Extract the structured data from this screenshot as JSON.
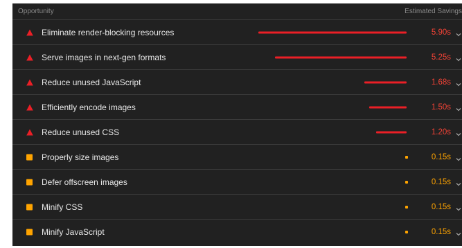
{
  "header": {
    "opportunity_label": "Opportunity",
    "savings_label": "Estimated Savings"
  },
  "colors": {
    "fail": "#eb1f26",
    "average": "#ffa400",
    "background": "#212121"
  },
  "rows": [
    {
      "label": "Eliminate render-blocking resources",
      "value": "5.90s",
      "seconds": 5.9,
      "status": "fail",
      "icon": "red-triangle-icon"
    },
    {
      "label": "Serve images in next-gen formats",
      "value": "5.25s",
      "seconds": 5.25,
      "status": "fail",
      "icon": "red-triangle-icon"
    },
    {
      "label": "Reduce unused JavaScript",
      "value": "1.68s",
      "seconds": 1.68,
      "status": "fail",
      "icon": "red-triangle-icon"
    },
    {
      "label": "Efficiently encode images",
      "value": "1.50s",
      "seconds": 1.5,
      "status": "fail",
      "icon": "red-triangle-icon"
    },
    {
      "label": "Reduce unused CSS",
      "value": "1.20s",
      "seconds": 1.2,
      "status": "fail",
      "icon": "red-triangle-icon"
    },
    {
      "label": "Properly size images",
      "value": "0.15s",
      "seconds": 0.15,
      "status": "average",
      "icon": "orange-square-icon"
    },
    {
      "label": "Defer offscreen images",
      "value": "0.15s",
      "seconds": 0.15,
      "status": "average",
      "icon": "orange-square-icon"
    },
    {
      "label": "Minify CSS",
      "value": "0.15s",
      "seconds": 0.15,
      "status": "average",
      "icon": "orange-square-icon"
    },
    {
      "label": "Minify JavaScript",
      "value": "0.15s",
      "seconds": 0.15,
      "status": "average",
      "icon": "orange-square-icon"
    }
  ]
}
